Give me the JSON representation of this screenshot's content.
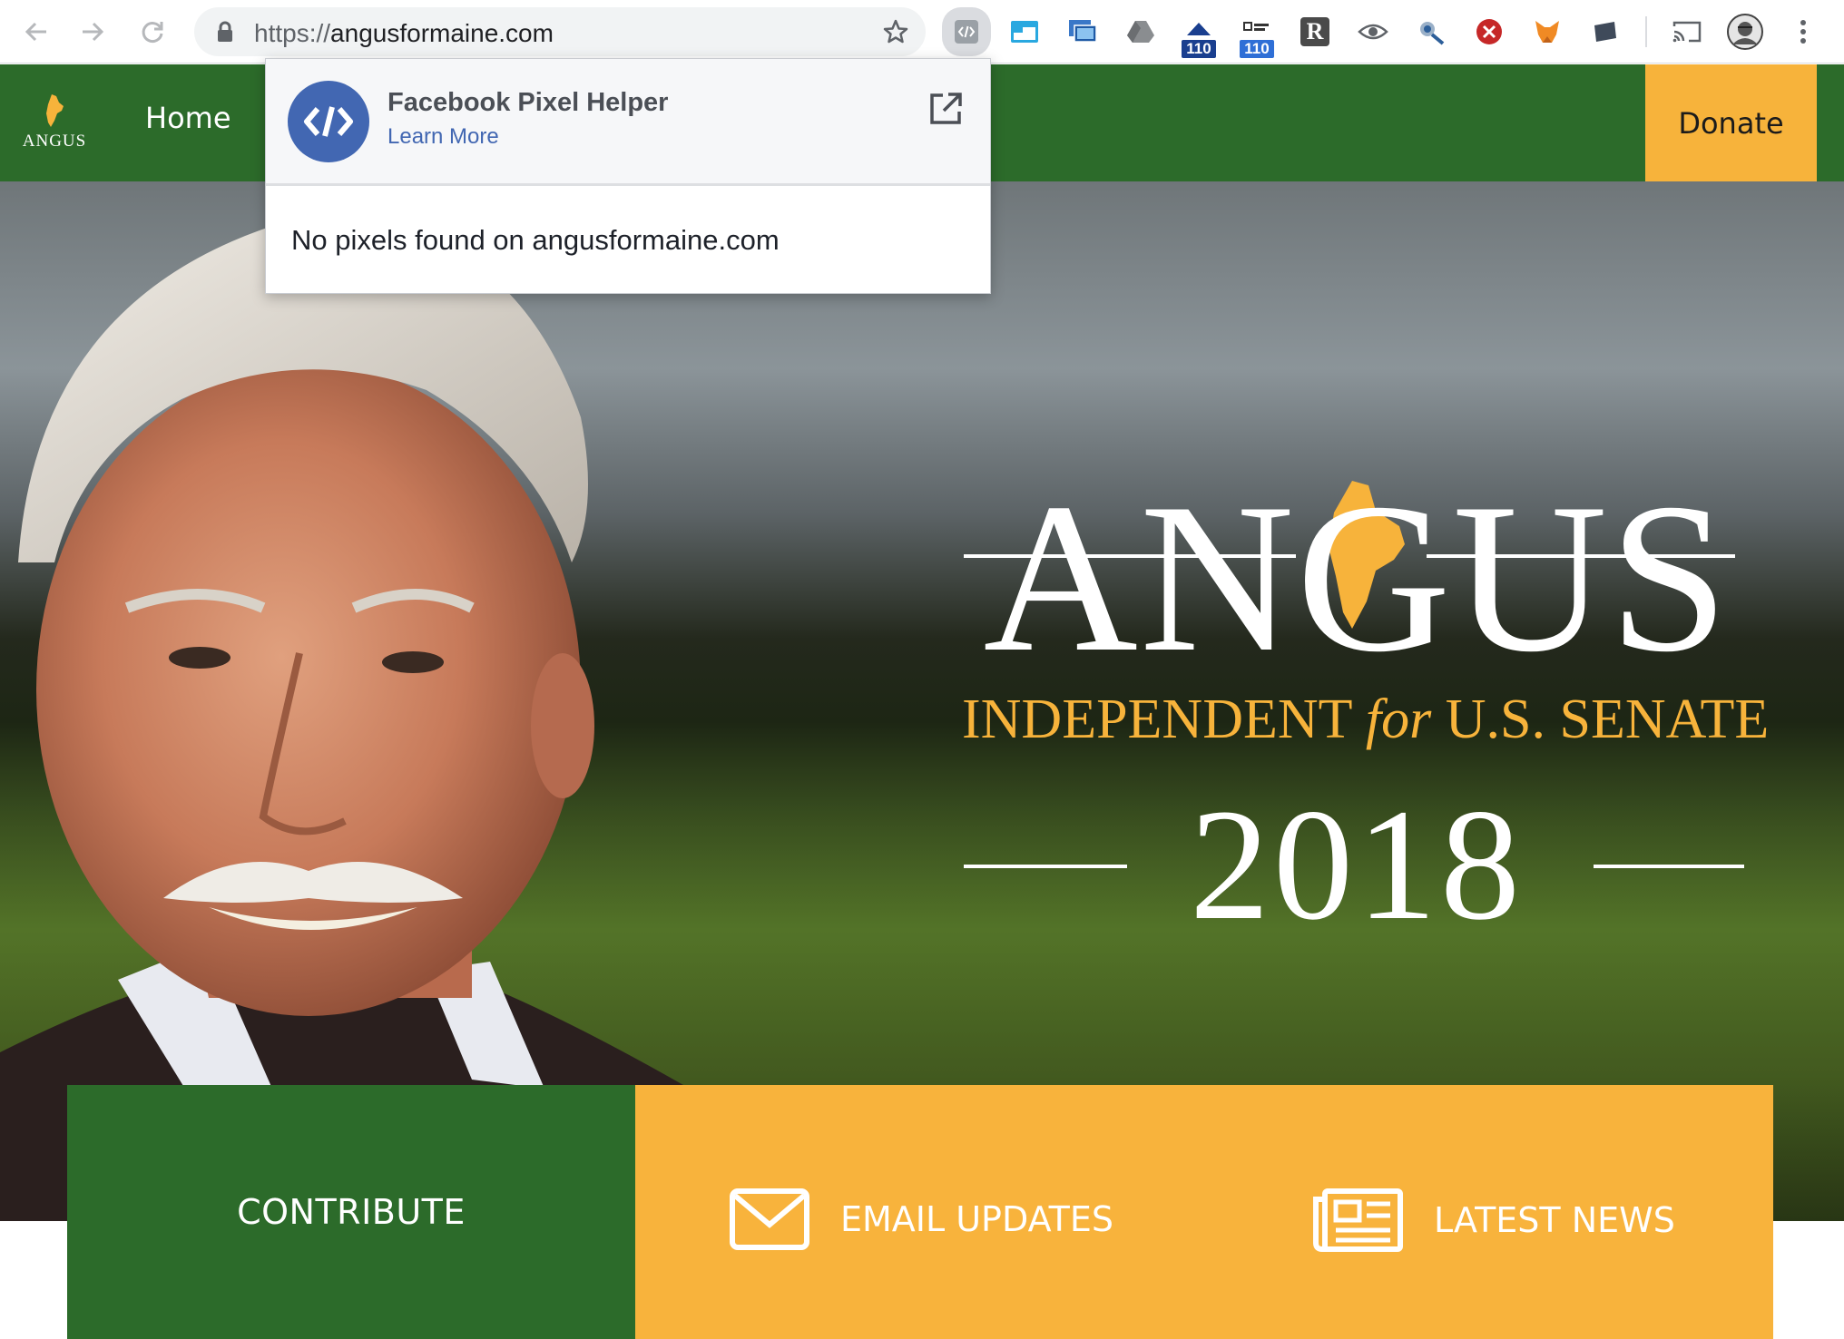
{
  "browser": {
    "url_scheme": "https://",
    "url_host": "angusformaine.com",
    "extensions": [
      {
        "name": "facebook-pixel-helper-icon"
      },
      {
        "name": "window-icon"
      },
      {
        "name": "screenshot-icon"
      },
      {
        "name": "drive-icon"
      },
      {
        "name": "extension-badge-icon",
        "badge": "110",
        "badge_color": "#1a3f8f"
      },
      {
        "name": "extension-badge-icon",
        "badge": "110",
        "badge_color": "#2f6fd6"
      },
      {
        "name": "readability-icon",
        "label": "R"
      },
      {
        "name": "eye-icon"
      },
      {
        "name": "satellite-icon"
      },
      {
        "name": "blocker-icon"
      },
      {
        "name": "metamask-fox-icon"
      },
      {
        "name": "folder-icon"
      },
      {
        "name": "cast-icon"
      },
      {
        "name": "profile-avatar-icon"
      },
      {
        "name": "menu-dots-icon"
      }
    ]
  },
  "site": {
    "logo_text": "ANGUS",
    "nav_home": "Home",
    "donate": "Donate",
    "accent": "#f7b33b",
    "brand_green": "#2c6b2a"
  },
  "hero": {
    "name": "ANGUS",
    "subtitle_pre": "INDEPENDENT ",
    "subtitle_em": "for",
    "subtitle_post": " U.S. SENATE",
    "year": "2018"
  },
  "cta": {
    "contribute": "CONTRIBUTE",
    "email": "EMAIL UPDATES",
    "news": "LATEST NEWS"
  },
  "popup": {
    "title": "Facebook Pixel Helper",
    "link": "Learn More",
    "message": "No pixels found on angusformaine.com"
  }
}
